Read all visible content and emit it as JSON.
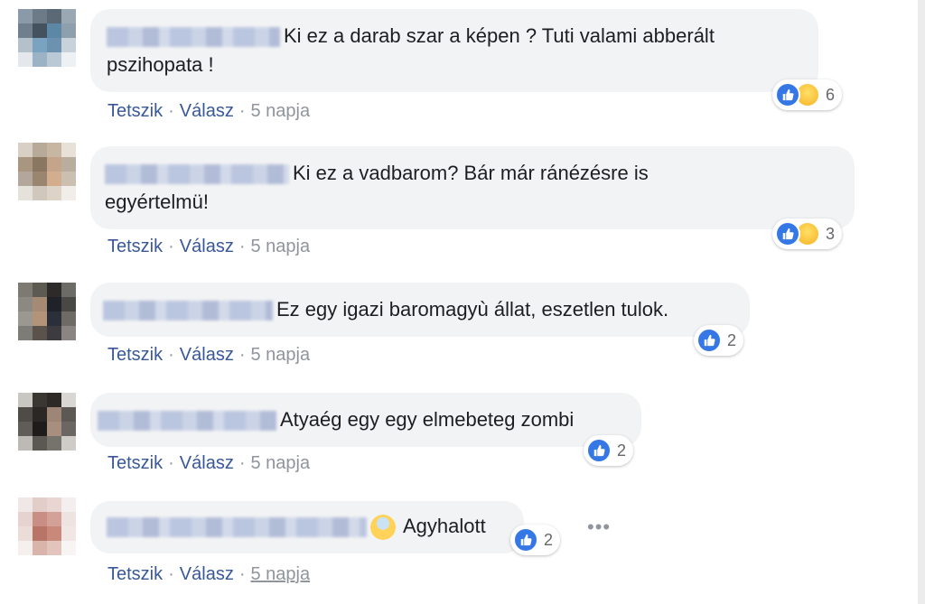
{
  "comments": [
    {
      "text": "Ki ez a darab szar a képen ? Tuti valami abberált pszihopata !",
      "reaction_count": "6",
      "reactions": [
        "like-icon",
        "haha-icon"
      ],
      "actions": {
        "like": "Tetszik",
        "reply": "Válasz",
        "time": "5 napja"
      }
    },
    {
      "text": "Ki ez a vadbarom? Bár már ránézésre is egyértelmü!",
      "reaction_count": "3",
      "reactions": [
        "like-icon",
        "haha-icon"
      ],
      "actions": {
        "like": "Tetszik",
        "reply": "Válasz",
        "time": "5 napja"
      }
    },
    {
      "text": "Ez egy igazi baromagyù állat, eszetlen tulok.",
      "reaction_count": "2",
      "reactions": [
        "like-icon"
      ],
      "actions": {
        "like": "Tetszik",
        "reply": "Válasz",
        "time": "5 napja"
      }
    },
    {
      "text": "Atyaég egy egy elmebeteg zombi",
      "reaction_count": "2",
      "reactions": [
        "like-icon"
      ],
      "actions": {
        "like": "Tetszik",
        "reply": "Válasz",
        "time": "5 napja"
      }
    },
    {
      "text": "Agyhalott",
      "reaction_count": "2",
      "reactions": [
        "like-icon"
      ],
      "emoji": "scream-emoji-icon",
      "actions": {
        "like": "Tetszik",
        "reply": "Válasz",
        "time": "5 napja"
      }
    }
  ],
  "more_menu_icon": "more-options-icon",
  "separator": "·",
  "colors": {
    "link": "#385898",
    "bubble": "#f2f3f5",
    "like": "#3578e5",
    "meta": "#90949c"
  }
}
